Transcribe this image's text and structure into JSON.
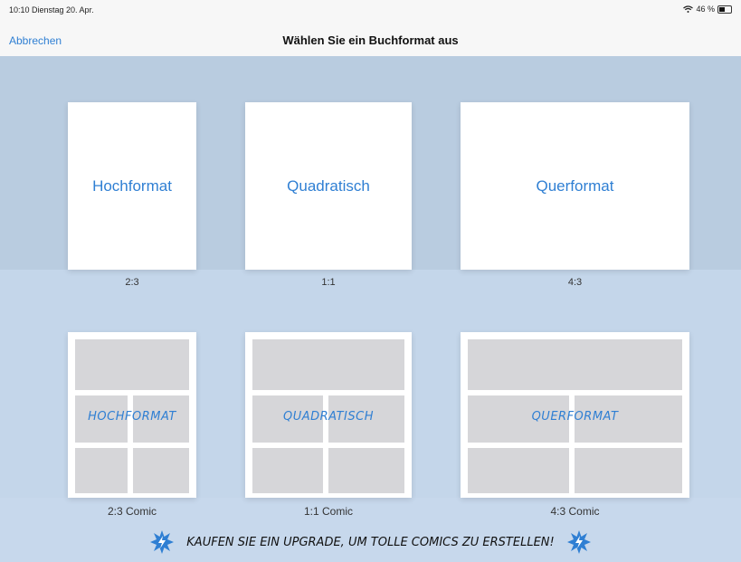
{
  "status": {
    "time": "10:10 Dienstag 20. Apr.",
    "battery": "46 %"
  },
  "nav": {
    "cancel": "Abbrechen",
    "title": "Wählen Sie ein Buchformat aus"
  },
  "formats": [
    {
      "label": "Hochformat",
      "ratio": "2:3"
    },
    {
      "label": "Quadratisch",
      "ratio": "1:1"
    },
    {
      "label": "Querformat",
      "ratio": "4:3"
    }
  ],
  "comics": [
    {
      "label": "HOCHFORMAT",
      "ratio": "2:3 Comic"
    },
    {
      "label": "QUADRATISCH",
      "ratio": "1:1 Comic"
    },
    {
      "label": "QUERFORMAT",
      "ratio": "4:3 Comic"
    }
  ],
  "upgrade": {
    "text": "KAUFEN SIE EIN UPGRADE, UM TOLLE COMICS ZU ERSTELLEN!"
  },
  "colors": {
    "accent": "#2f7fd3",
    "background": "#c3d4e6"
  },
  "icons": [
    "wifi-icon",
    "battery-icon",
    "lightning-burst-icon"
  ]
}
